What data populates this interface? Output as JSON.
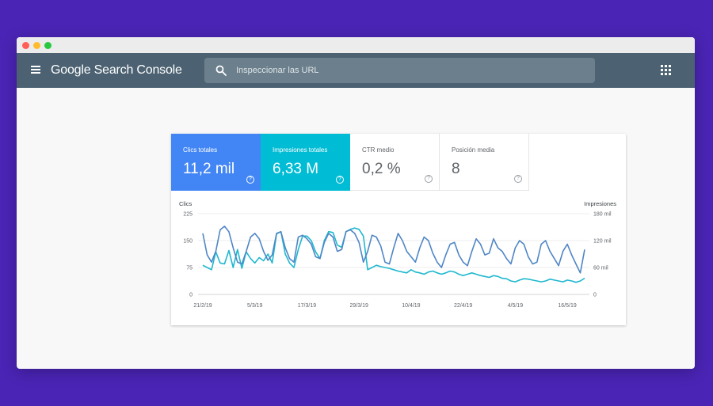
{
  "app": {
    "brand_google": "Google",
    "brand_product": "Search Console",
    "search_placeholder": "Inspeccionar las URL",
    "icons": {
      "menu": "hamburger-menu-icon",
      "search": "search-icon",
      "apps": "apps-grid-icon"
    }
  },
  "metrics": [
    {
      "label": "Clics totales",
      "value": "11,2 mil",
      "color": "#4285f4"
    },
    {
      "label": "Impresiones totales",
      "value": "6,33 M",
      "color": "#00bcd4"
    },
    {
      "label": "CTR medio",
      "value": "0,2 %"
    },
    {
      "label": "Posición media",
      "value": "8"
    }
  ],
  "help_glyph": "?",
  "chart_data": {
    "type": "line",
    "title": "",
    "ylabel_left": "Clics",
    "ylabel_right": "Impresiones",
    "ylim_left": [
      0,
      225
    ],
    "ylim_right": [
      0,
      180
    ],
    "yticks_left": [
      "0",
      "75",
      "150",
      "225"
    ],
    "yticks_right": [
      "0",
      "60 mil",
      "120 mil",
      "180 mil"
    ],
    "xtick_labels": [
      "21/2/19",
      "5/3/19",
      "17/3/19",
      "29/3/19",
      "10/4/19",
      "22/4/19",
      "4/5/19",
      "16/5/19"
    ],
    "xtick_index": [
      0,
      12,
      24,
      36,
      48,
      60,
      72,
      84
    ],
    "grid": true,
    "series": [
      {
        "name": "Clics",
        "axis": "left",
        "color": "#4f86c6",
        "values": [
          170,
          110,
          90,
          120,
          180,
          190,
          175,
          130,
          90,
          85,
          120,
          160,
          170,
          155,
          120,
          95,
          110,
          170,
          175,
          130,
          100,
          90,
          160,
          165,
          155,
          140,
          105,
          100,
          145,
          170,
          160,
          120,
          125,
          175,
          180,
          170,
          145,
          90,
          120,
          165,
          160,
          135,
          90,
          85,
          130,
          170,
          150,
          120,
          105,
          90,
          130,
          160,
          150,
          115,
          90,
          75,
          110,
          140,
          145,
          110,
          90,
          80,
          120,
          155,
          140,
          110,
          115,
          155,
          130,
          120,
          100,
          85,
          130,
          150,
          140,
          105,
          85,
          90,
          140,
          150,
          120,
          100,
          80,
          120,
          140,
          110,
          85,
          60,
          125
        ]
      },
      {
        "name": "Impresiones",
        "axis": "right",
        "color": "#1fb8cf",
        "values": [
          65,
          60,
          55,
          95,
          70,
          68,
          98,
          60,
          100,
          58,
          95,
          80,
          70,
          82,
          75,
          90,
          70,
          135,
          140,
          90,
          70,
          60,
          100,
          130,
          130,
          120,
          95,
          80,
          120,
          140,
          138,
          110,
          105,
          140,
          145,
          148,
          145,
          130,
          55,
          60,
          65,
          62,
          60,
          58,
          55,
          52,
          50,
          48,
          55,
          50,
          48,
          45,
          50,
          52,
          48,
          45,
          48,
          52,
          50,
          45,
          42,
          45,
          48,
          45,
          42,
          40,
          38,
          42,
          40,
          36,
          35,
          30,
          28,
          32,
          35,
          34,
          32,
          30,
          28,
          30,
          34,
          32,
          30,
          28,
          32,
          30,
          27,
          30,
          36
        ]
      }
    ]
  }
}
